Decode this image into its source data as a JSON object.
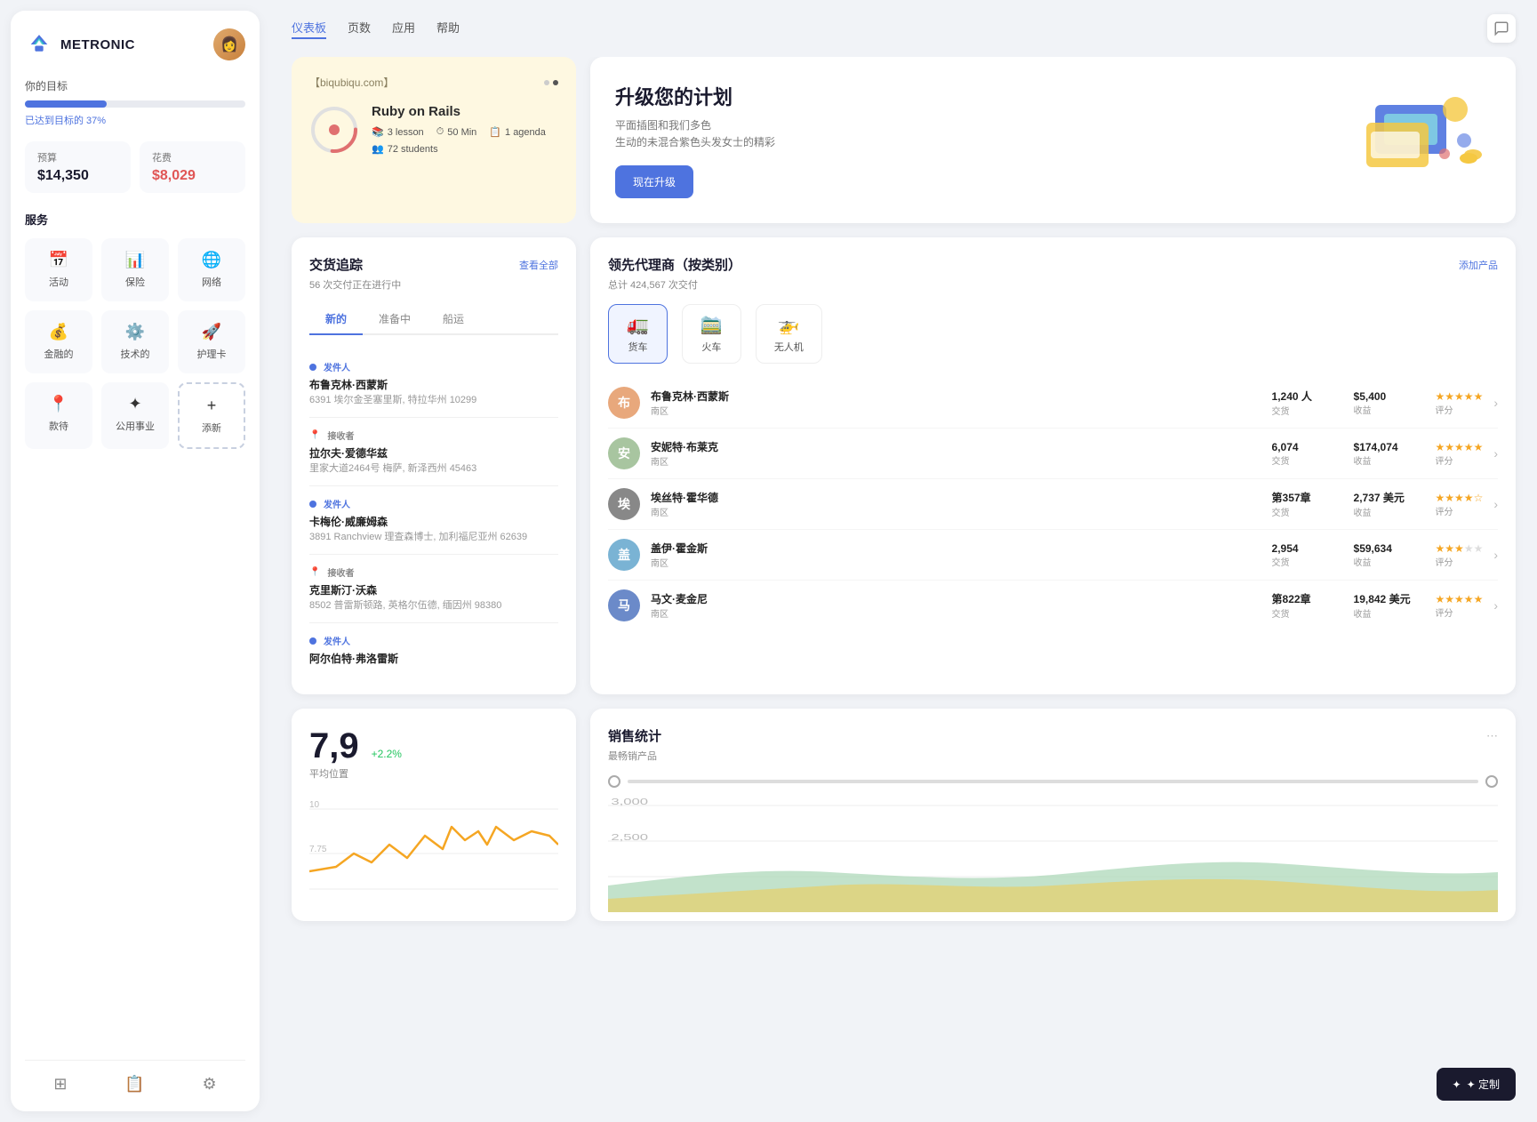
{
  "sidebar": {
    "logo_text": "METRONIC",
    "goal_label": "你的目标",
    "progress_pct": 37,
    "progress_text": "已达到目标的 37%",
    "budget_label": "预算",
    "budget_value": "$14,350",
    "expense_label": "花费",
    "expense_value": "$8,029",
    "services_title": "服务",
    "services": [
      {
        "label": "活动",
        "icon": "📅"
      },
      {
        "label": "保险",
        "icon": "📊"
      },
      {
        "label": "网络",
        "icon": "🌐"
      },
      {
        "label": "金融的",
        "icon": "💰"
      },
      {
        "label": "技术的",
        "icon": "⚙️"
      },
      {
        "label": "护理卡",
        "icon": "🚀"
      },
      {
        "label": "款待",
        "icon": "📍"
      },
      {
        "label": "公用事业",
        "icon": "✦"
      },
      {
        "label": "添新",
        "icon": "+"
      }
    ],
    "footer_icons": [
      "layers",
      "card",
      "settings"
    ]
  },
  "topnav": {
    "links": [
      {
        "label": "仪表板",
        "active": true
      },
      {
        "label": "页数",
        "active": false
      },
      {
        "label": "应用",
        "active": false
      },
      {
        "label": "帮助",
        "active": false
      }
    ]
  },
  "course_card": {
    "url": "【biqubiqu.com】",
    "title": "Ruby on Rails",
    "lessons": "3 lesson",
    "duration": "50 Min",
    "agenda": "1 agenda",
    "students": "72 students"
  },
  "upgrade_card": {
    "title": "升级您的计划",
    "desc_line1": "平面插图和我们多色",
    "desc_line2": "生动的未混合紫色头发女士的精彩",
    "btn_label": "现在升级"
  },
  "delivery": {
    "title": "交货追踪",
    "subtitle": "56 次交付正在进行中",
    "view_all": "查看全部",
    "tabs": [
      "新的",
      "准备中",
      "船运"
    ],
    "active_tab": 0,
    "items": [
      {
        "role": "发件人",
        "role_type": "sender",
        "name": "布鲁克林·西蒙斯",
        "address": "6391 埃尔金圣塞里斯, 特拉华州 10299"
      },
      {
        "role": "接收者",
        "role_type": "receiver",
        "name": "拉尔夫·爱德华兹",
        "address": "里家大道2464号 梅萨, 新泽西州 45463"
      },
      {
        "role": "发件人",
        "role_type": "sender",
        "name": "卡梅伦·威廉姆森",
        "address": "3891 Ranchview 理查森博士, 加利福尼亚州 62639"
      },
      {
        "role": "接收者",
        "role_type": "receiver",
        "name": "克里斯汀·沃森",
        "address": "8502 普雷斯顿路, 英格尔伍德, 缅因州 98380"
      },
      {
        "role": "发件人",
        "role_type": "sender",
        "name": "阿尔伯特·弗洛雷斯",
        "address": ""
      }
    ]
  },
  "agents": {
    "title": "领先代理商（按类别）",
    "subtitle": "总计 424,567 次交付",
    "add_btn": "添加产品",
    "categories": [
      {
        "label": "货车",
        "icon": "🚛",
        "active": true
      },
      {
        "label": "火车",
        "icon": "🚞",
        "active": false
      },
      {
        "label": "无人机",
        "icon": "🚁",
        "active": false
      }
    ],
    "rows": [
      {
        "name": "布鲁克林·西蒙斯",
        "region": "南区",
        "transactions": "1,240 人",
        "trans_label": "交货",
        "revenue": "$5,400",
        "rev_label": "收益",
        "stars": 5,
        "rating_label": "评分",
        "color": "#e8a87c"
      },
      {
        "name": "安妮特·布莱克",
        "region": "南区",
        "transactions": "6,074",
        "trans_label": "交货",
        "revenue": "$174,074",
        "rev_label": "收益",
        "stars": 5,
        "rating_label": "评分",
        "color": "#a8c5a0"
      },
      {
        "name": "埃丝特·霍华德",
        "region": "南区",
        "transactions": "第357章",
        "trans_label": "交货",
        "revenue": "2,737 美元",
        "rev_label": "收益",
        "stars": 4,
        "rating_label": "评分",
        "color": "#888"
      },
      {
        "name": "盖伊·霍金斯",
        "region": "南区",
        "transactions": "2,954",
        "trans_label": "交货",
        "revenue": "$59,634",
        "rev_label": "收益",
        "stars": 3.5,
        "rating_label": "评分",
        "color": "#7ab3d4"
      },
      {
        "name": "马文·麦金尼",
        "region": "南区",
        "transactions": "第822章",
        "trans_label": "交货",
        "revenue": "19,842 美元",
        "rev_label": "收益",
        "stars": 5,
        "rating_label": "评分",
        "color": "#6b8ac9"
      }
    ]
  },
  "avg_card": {
    "value": "7,9",
    "trend": "+2.2%",
    "label": "平均位置",
    "y_labels": [
      "10",
      "7.75"
    ],
    "chart_color": "#f5a623"
  },
  "sales_card": {
    "title": "销售统计",
    "subtitle": "最畅销产品",
    "dots_icon": "⋯"
  },
  "customize_btn": "✦ 定制"
}
